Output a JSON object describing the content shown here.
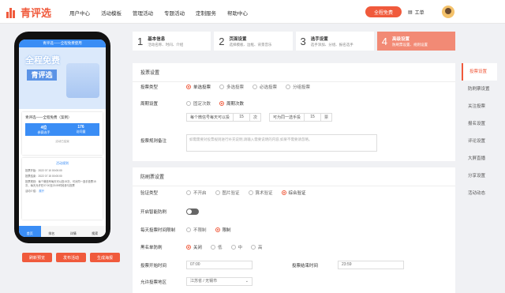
{
  "brand": {
    "name": "青评选",
    "color": "#f05a3c"
  },
  "nav": [
    "用户中心",
    "活动模板",
    "管理活动",
    "专题活动",
    "定制服务",
    "帮助中心"
  ],
  "header": {
    "free_button": "全程免费",
    "work_label": "工单"
  },
  "phone": {
    "title_bar": "青评选——全程免费使用",
    "banner_line1": "全程免费",
    "banner_line2": "青评选",
    "activity_name": "青评选——全程免费（案例）",
    "stats": [
      {
        "value": "4位",
        "label": "参赛选手"
      },
      {
        "value": "176",
        "label": "访问量"
      }
    ],
    "ended": "活动已结束",
    "rules_title": "活动规则",
    "rules": [
      "投票开始：2022 07 10 00:00:00",
      "投票结束：2022 07 15 00:00:00",
      "投票规则：每个微信号每天可以投15次，可对同一选手投票15次，每天允许在07:00至23:59时段参与投票",
      "活动介绍："
    ],
    "rules_more": "展开",
    "tabs": [
      "首页",
      "排名",
      "详情",
      "搜索"
    ]
  },
  "phone_buttons": [
    "刷新预览",
    "发布活动",
    "生成海报"
  ],
  "steps": [
    {
      "num": "1",
      "title": "基本信息",
      "sub": "活动名称、时间、介绍"
    },
    {
      "num": "2",
      "title": "页面设置",
      "sub": "选择模板、边框、背景音乐"
    },
    {
      "num": "3",
      "title": "选手设置",
      "sub": "选手添加、分组、报名选手"
    },
    {
      "num": "4",
      "title": "高级设置",
      "sub": "防刷票设置、规则设置"
    }
  ],
  "vote_settings": {
    "title": "投票设置",
    "type_label": "投票类型",
    "type_options": [
      "单选投票",
      "多选投票",
      "必选投票",
      "分组投票"
    ],
    "type_selected": 0,
    "cycle_label": "周期设置",
    "cycle_options": [
      "固定次数",
      "周期次数"
    ],
    "cycle_selected": 1,
    "per_day_label": "每个微信号每天可以投",
    "per_day_value": "15",
    "times_unit": "次",
    "same_label": "可为同一选手投",
    "same_value": "15",
    "ticket_unit": "票",
    "remark_label": "投票规则备注",
    "remark_placeholder": "如需需要对投票规则进行补充说明,请输入需要说明的内容,如果不需要请忽略。"
  },
  "anti_settings": {
    "title": "防刷票设置",
    "verify_label": "验证类型",
    "verify_options": [
      "不开启",
      "图片验证",
      "算术验证",
      "综合验证"
    ],
    "verify_selected": 3,
    "smart_label": "开启智能防刷",
    "time_limit_label": "每天投票时间限制",
    "time_limit_options": [
      "不限制",
      "限制"
    ],
    "time_limit_selected": 1,
    "blacklist_label": "黑名单防刷",
    "blacklist_options": [
      "关闭",
      "低",
      "中",
      "高"
    ],
    "blacklist_selected": 0,
    "start_label": "投票开始时间",
    "start_value": "07:00",
    "end_label": "投票结束时间",
    "end_value": "23:59",
    "region_label": "允许投票地区",
    "region_value": "江苏省 / 无锡市"
  },
  "side": [
    "投票设置",
    "防刷票设置",
    "关注投票",
    "报名设置",
    "评论设置",
    "大屏直播",
    "分享设置",
    "活动动态"
  ]
}
